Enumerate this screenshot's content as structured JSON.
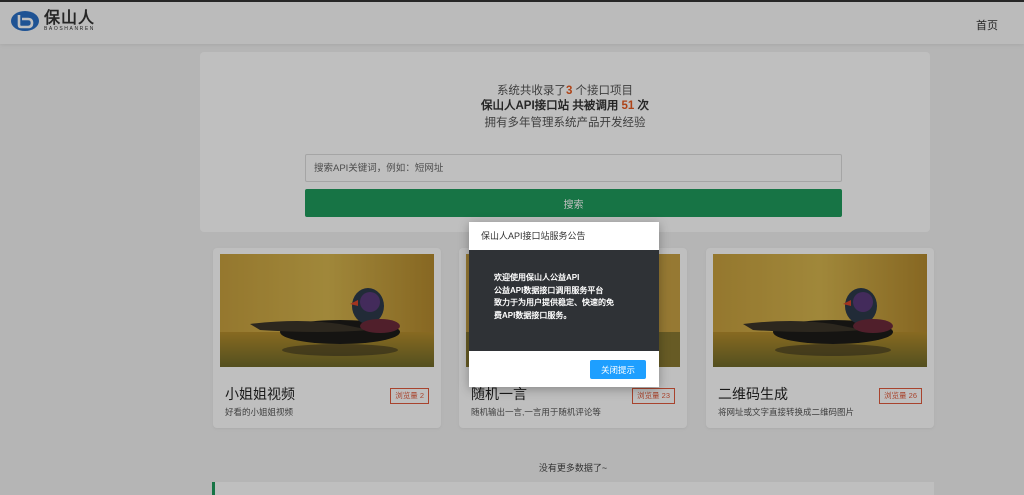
{
  "header": {
    "logo_name": "保山人",
    "logo_sub": "BAOSHANREN",
    "nav_home": "首页"
  },
  "hero": {
    "line1_pre": "系统共收录了",
    "line1_count": "3",
    "line1_post": " 个接口项目",
    "line2_pre": "保山人API接口站 共被调用 ",
    "line2_count": "51",
    "line2_post": " 次",
    "line3": "拥有多年管理系统产品开发经验"
  },
  "search": {
    "placeholder": "搜索API关键词，例如：短网址",
    "button_label": "搜索"
  },
  "cards": [
    {
      "title": "小姐姐视频",
      "desc": "好看的小姐姐视频",
      "badge": "浏览量 2"
    },
    {
      "title": "随机一言",
      "desc": "随机输出一言,一言用于随机评论等",
      "badge": "浏览量 23"
    },
    {
      "title": "二维码生成",
      "desc": "将网址或文字直接转换成二维码图片",
      "badge": "浏览量 26"
    }
  ],
  "footer": {
    "no_more": "没有更多数据了~"
  },
  "modal": {
    "title": "保山人API接口站服务公告",
    "body_line1": "欢迎使用保山人公益API",
    "body_line2": "公益API数据接口调用服务平台",
    "body_line3": "致力于为用户提供稳定、快速的免",
    "body_line4": "费API数据接口服务。",
    "close_label": "关闭提示"
  },
  "colors": {
    "accent_green": "#1f9b5c",
    "highlight_orange": "#e95a1f",
    "modal_button_blue": "#1e9fff",
    "modal_body_dark": "#2f3236"
  }
}
